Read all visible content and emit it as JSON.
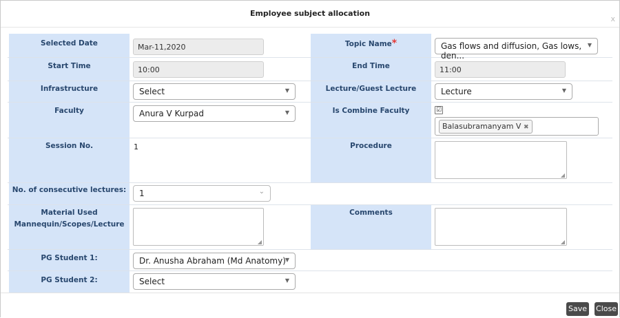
{
  "dialog": {
    "title": "Employee subject allocation",
    "close": "x"
  },
  "form": {
    "selected_date": {
      "label": "Selected Date",
      "value": "Mar-11,2020"
    },
    "topic_name": {
      "label": "Topic Name",
      "required_mark": "*",
      "value": "Gas flows and diffusion, Gas lows, den..."
    },
    "start_time": {
      "label": "Start Time",
      "value": "10:00"
    },
    "end_time": {
      "label": "End Time",
      "value": "11:00"
    },
    "infrastructure": {
      "label": "Infrastructure",
      "value": "Select"
    },
    "lecture_type": {
      "label": "Lecture/Guest Lecture",
      "value": "Lecture"
    },
    "faculty": {
      "label": "Faculty",
      "value": "Anura V Kurpad"
    },
    "combine_faculty": {
      "label": "Is Combine Faculty",
      "checked": "☑",
      "tag": "Balasubramanyam V",
      "tag_remove": "✖"
    },
    "session_no": {
      "label": "Session No.",
      "value": "1"
    },
    "procedure": {
      "label": "Procedure"
    },
    "consecutive": {
      "label": "No. of consecutive lectures:",
      "value": "1"
    },
    "material": {
      "label_line1": "Material Used",
      "label_line2": "Mannequin/Scopes/Lecture"
    },
    "comments": {
      "label": "Comments"
    },
    "pg1": {
      "label": "PG Student 1:",
      "value": "Dr. Anusha Abraham (Md Anatomy)"
    },
    "pg2": {
      "label": "PG Student 2:",
      "value": "Select"
    }
  },
  "footer": {
    "save": "Save",
    "close": "Close"
  }
}
